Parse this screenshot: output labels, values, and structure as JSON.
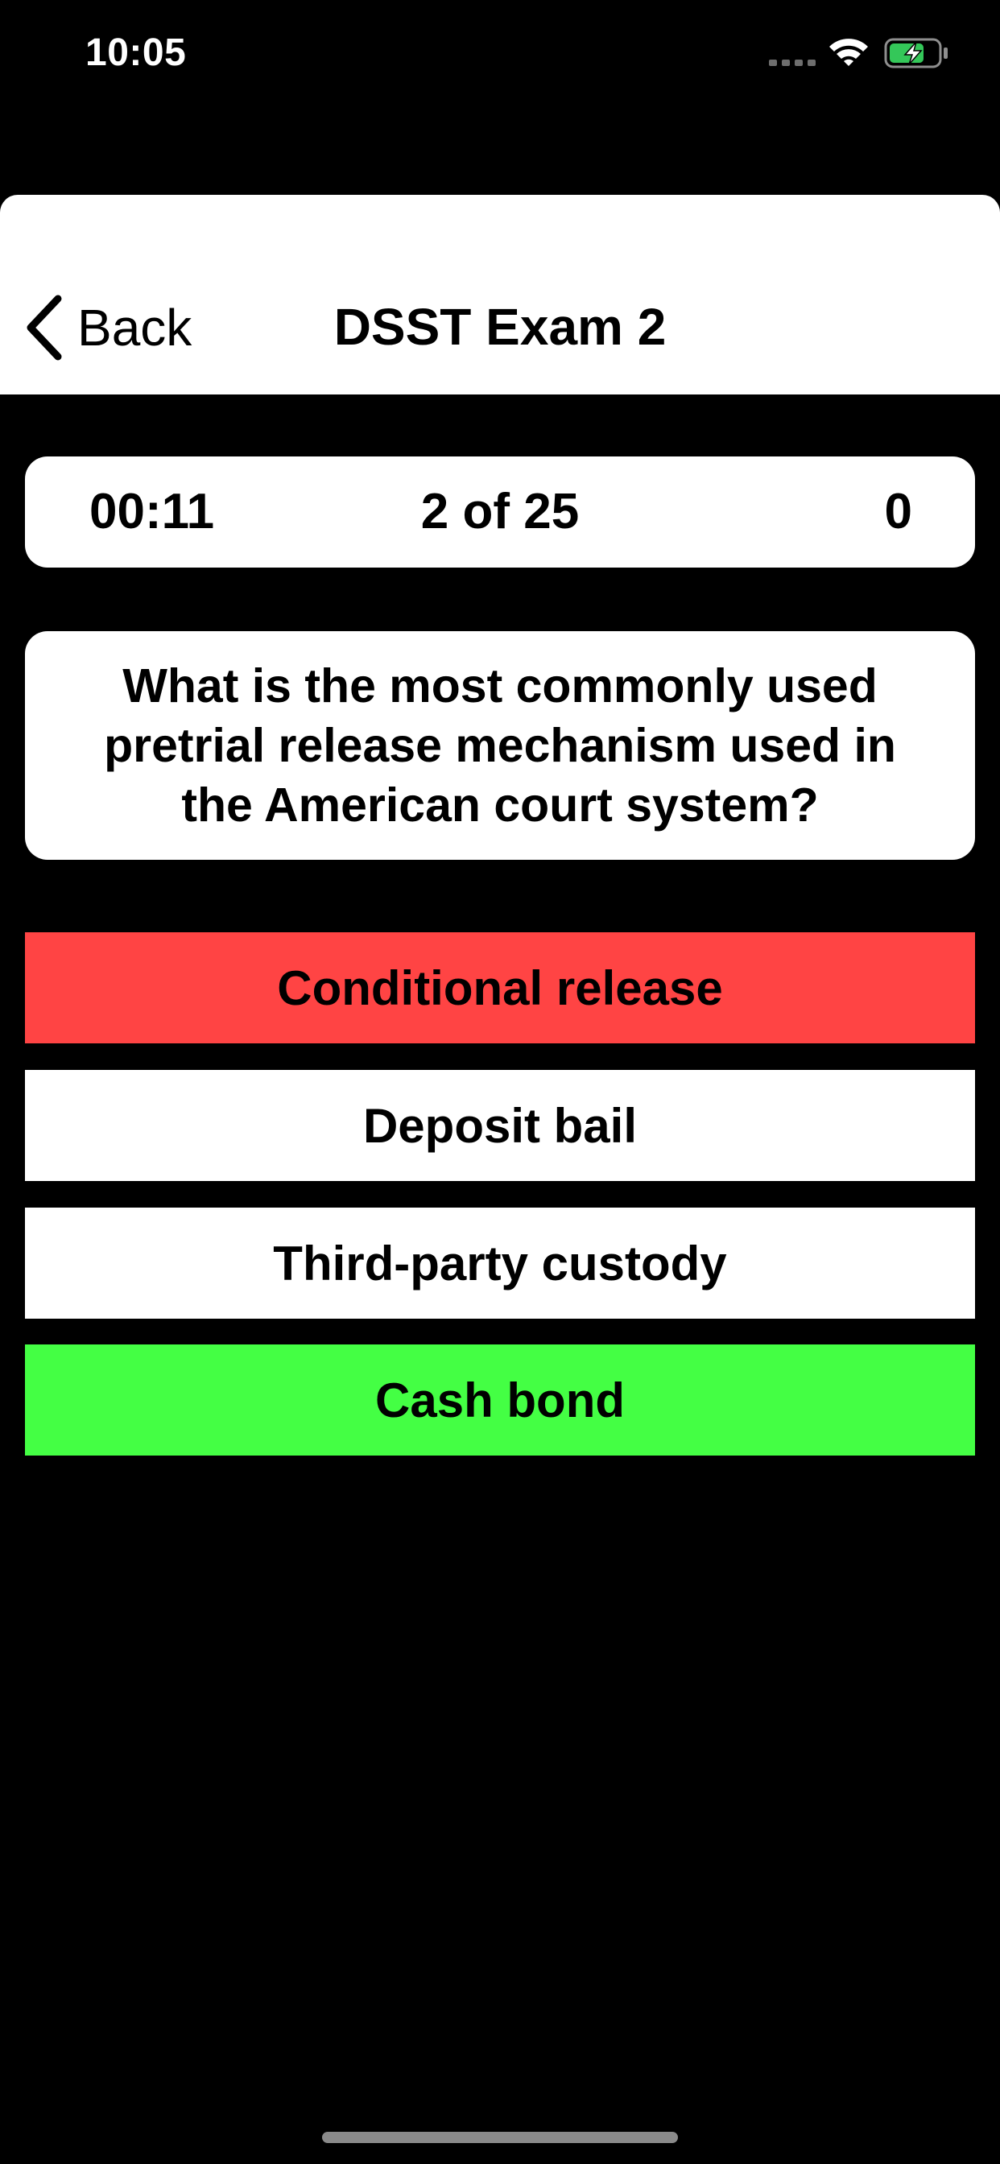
{
  "status_bar": {
    "time": "10:05",
    "battery_color": "#34c759"
  },
  "nav": {
    "back_label": "Back",
    "title": "DSST Exam 2"
  },
  "info": {
    "timer": "00:11",
    "progress": "2 of 25",
    "score": "0"
  },
  "question": {
    "text": "What is the most commonly used pretrial release mechanism used in the American court system?"
  },
  "answers": [
    {
      "label": "Conditional release",
      "state": "incorrect",
      "color": "#ff4444"
    },
    {
      "label": "Deposit bail",
      "state": "neutral",
      "color": "#ffffff"
    },
    {
      "label": "Third-party custody",
      "state": "neutral",
      "color": "#ffffff"
    },
    {
      "label": "Cash bond",
      "state": "correct",
      "color": "#44ff44"
    }
  ]
}
